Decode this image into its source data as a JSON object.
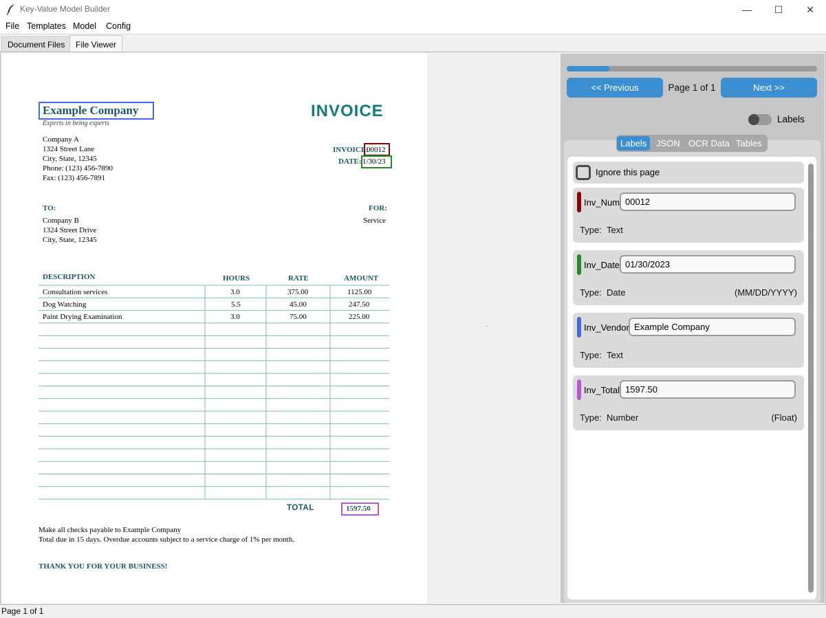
{
  "window": {
    "title": "Key-Value Model Builder",
    "minimize_glyph": "—",
    "maximize_glyph": "☐",
    "close_glyph": "✕"
  },
  "menubar": [
    "File",
    "Templates",
    "Model",
    "Config"
  ],
  "tabs": [
    {
      "label": "Document Files",
      "active": false
    },
    {
      "label": "File Viewer",
      "active": true
    }
  ],
  "document": {
    "company_name": "Example Company",
    "tagline": "Experts in being experts",
    "heading": "INVOICE",
    "sender": [
      "Company A",
      "1324 Street Lane",
      "City, State, 12345",
      "Phone: (123) 456-7890",
      "Fax: (123) 456-7891"
    ],
    "invoice_label": "INVOICE:",
    "invoice_value": "00012",
    "date_label": "DATE:",
    "date_value": "1/30/23",
    "to_label": "TO:",
    "recipient": [
      "Company B",
      "1324 Street Drive",
      "City, State, 12345"
    ],
    "for_label": "FOR:",
    "for_value": "Service",
    "columns": [
      "DESCRIPTION",
      "HOURS",
      "RATE",
      "AMOUNT"
    ],
    "rows": [
      [
        "Consultation services",
        "3.0",
        "375.00",
        "1125.00"
      ],
      [
        "Dog Watching",
        "5.5",
        "45.00",
        "247.50"
      ],
      [
        "Paint Drying Examination",
        "3.0",
        "75.00",
        "225.00"
      ]
    ],
    "total_label": "TOTAL",
    "total_value": "1597.50",
    "footer": [
      "Make all checks payable to Example Company",
      "Total due in 15 days. Overdue accounts subject to a service charge of 1% per month."
    ],
    "thanks": "THANK YOU FOR YOUR BUSINESS!"
  },
  "viewer": {
    "progress_fraction": 0.17,
    "prev_label": "<< Previous",
    "next_label": "Next >>",
    "page_indicator": "Page 1 of 1",
    "labels_toggle": "Labels",
    "panel_tabs": [
      "Labels",
      "JSON",
      "OCR Data",
      "Tables"
    ],
    "active_panel_tab": "Labels",
    "ignore_label": "Ignore this page",
    "type_prefix": "Type:",
    "fields": [
      {
        "name": "Inv_Num:",
        "value": "00012",
        "type": "Text",
        "format": "",
        "color": "#8b0000"
      },
      {
        "name": "Inv_Date:",
        "value": "01/30/2023",
        "type": "Date",
        "format": "(MM/DD/YYYY)",
        "color": "#228b22"
      },
      {
        "name": "Inv_Vendor:",
        "value": "Example Company",
        "type": "Text",
        "format": "",
        "color": "#4169e1"
      },
      {
        "name": "Inv_Total:",
        "value": "1597.50",
        "type": "Number",
        "format": "(Float)",
        "color": "#ba55d3"
      }
    ]
  },
  "status": "Page 1 of 1",
  "colors": {
    "accent": "#3b8ed0",
    "doc_teal": "#1f5667",
    "invoice_teal": "#147a7a",
    "grid_line": "#7fb8b8"
  }
}
